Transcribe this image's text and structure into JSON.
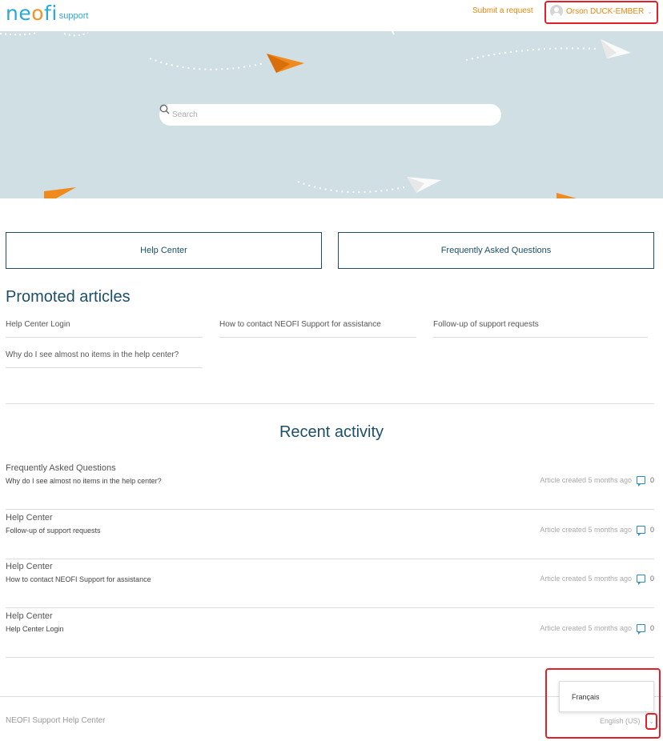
{
  "header": {
    "logo_word_a": "ne",
    "logo_word_o": "o",
    "logo_word_b": "fi",
    "logo_sub": "support",
    "submit_link": "Submit a request",
    "user_name": "Orson DUCK-EMBER",
    "chevron": "⌄"
  },
  "search": {
    "placeholder": "Search"
  },
  "categories": [
    {
      "label": "Help Center"
    },
    {
      "label": "Frequently Asked Questions"
    }
  ],
  "promoted": {
    "title": "Promoted articles",
    "items": [
      "Help Center Login",
      "How to contact NEOFI Support for assistance",
      "Follow-up of support requests",
      "Why do I see almost no items in the help center?"
    ]
  },
  "recent": {
    "title": "Recent activity",
    "items": [
      {
        "section": "Frequently Asked Questions",
        "article": "Why do I see almost no items in the help center?",
        "meta": "Article created 5 months ago",
        "comments": "0"
      },
      {
        "section": "Help Center",
        "article": "Follow-up of support requests",
        "meta": "Article created 5 months ago",
        "comments": "0"
      },
      {
        "section": "Help Center",
        "article": "How to contact NEOFI Support for assistance",
        "meta": "Article created 5 months ago",
        "comments": "0"
      },
      {
        "section": "Help Center",
        "article": "Help Center Login",
        "meta": "Article created 5 months ago",
        "comments": "0"
      }
    ]
  },
  "footer": {
    "text": "NEOFI Support Help Center",
    "language_current": "English (US)",
    "language_option": "Français",
    "chevron": "⌄"
  },
  "colors": {
    "brand_blue": "#2aa8d8",
    "brand_orange": "#f39224",
    "title_navy": "#1d4f6a",
    "hero_bg": "#cfdfe3",
    "highlight_red": "#e2202a"
  }
}
